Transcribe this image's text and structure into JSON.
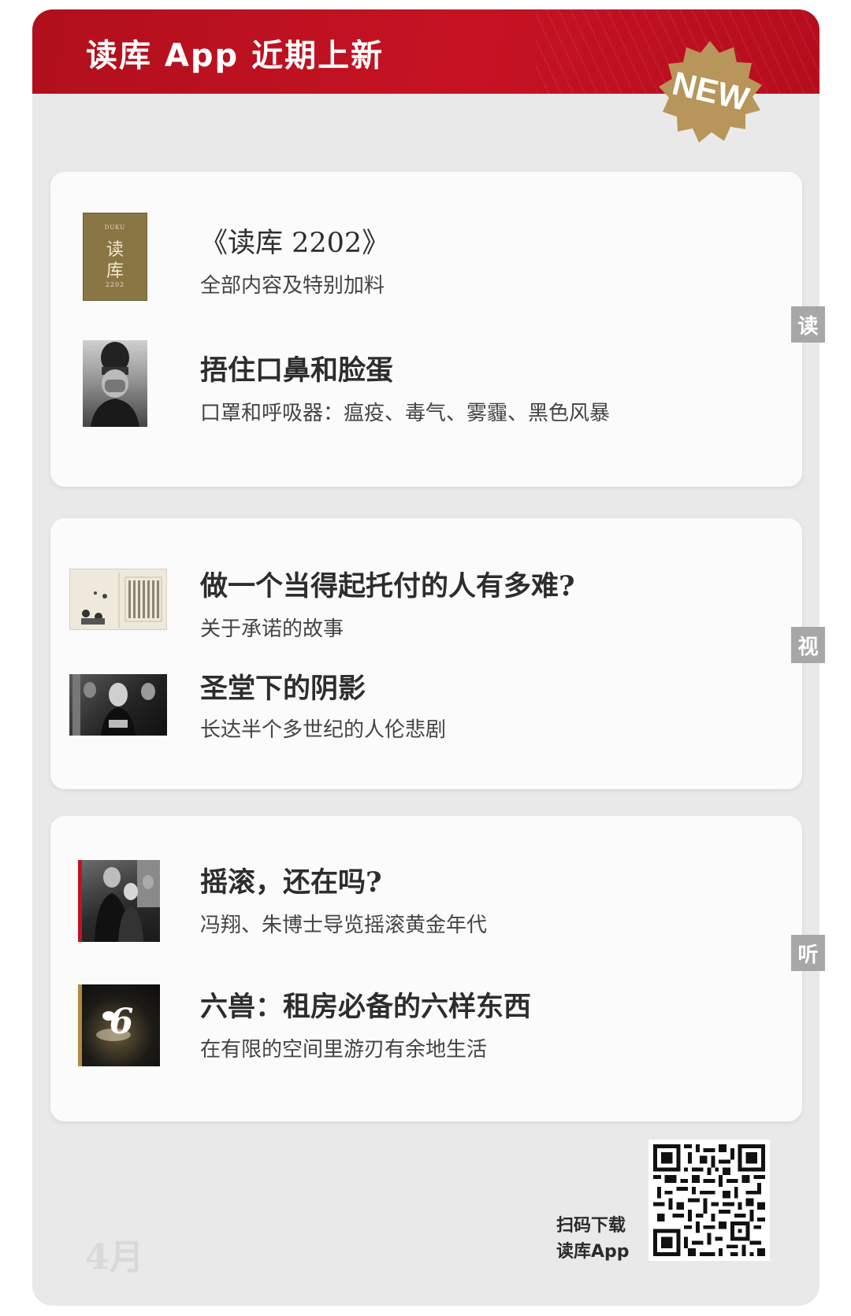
{
  "header": {
    "title": "读库 App 近期上新",
    "badge": "NEW"
  },
  "sections": [
    {
      "tab": "读",
      "items": [
        {
          "title": "《读库 2202》",
          "subtitle": "全部内容及特别加料",
          "cover": {
            "top_text": "DUKU",
            "chars": [
              "读",
              "库"
            ],
            "year": "2202"
          }
        },
        {
          "title": "捂住口鼻和脸蛋",
          "subtitle": "口罩和呼吸器：瘟疫、毒气、雾霾、黑色风暴"
        }
      ]
    },
    {
      "tab": "视",
      "items": [
        {
          "title": "做一个当得起托付的人有多难?",
          "subtitle": "关于承诺的故事"
        },
        {
          "title": "圣堂下的阴影",
          "subtitle": "长达半个多世纪的人伦悲剧"
        }
      ]
    },
    {
      "tab": "听",
      "items": [
        {
          "title": "摇滚，还在吗?",
          "subtitle": "冯翔、朱博士导览摇滚黄金年代"
        },
        {
          "title": "六兽：租房必备的六样东西",
          "subtitle": "在有限的空间里游刃有余地生活",
          "thumb_digit": "6"
        }
      ]
    }
  ],
  "footer": {
    "month": "4月",
    "scan_line1": "扫码下载",
    "scan_line2": "读库App"
  },
  "colors": {
    "header_red": "#c61324",
    "badge_gold": "#b8955a",
    "tab_gray": "#a7a7a7",
    "panel_bg": "#e9e9e9"
  }
}
